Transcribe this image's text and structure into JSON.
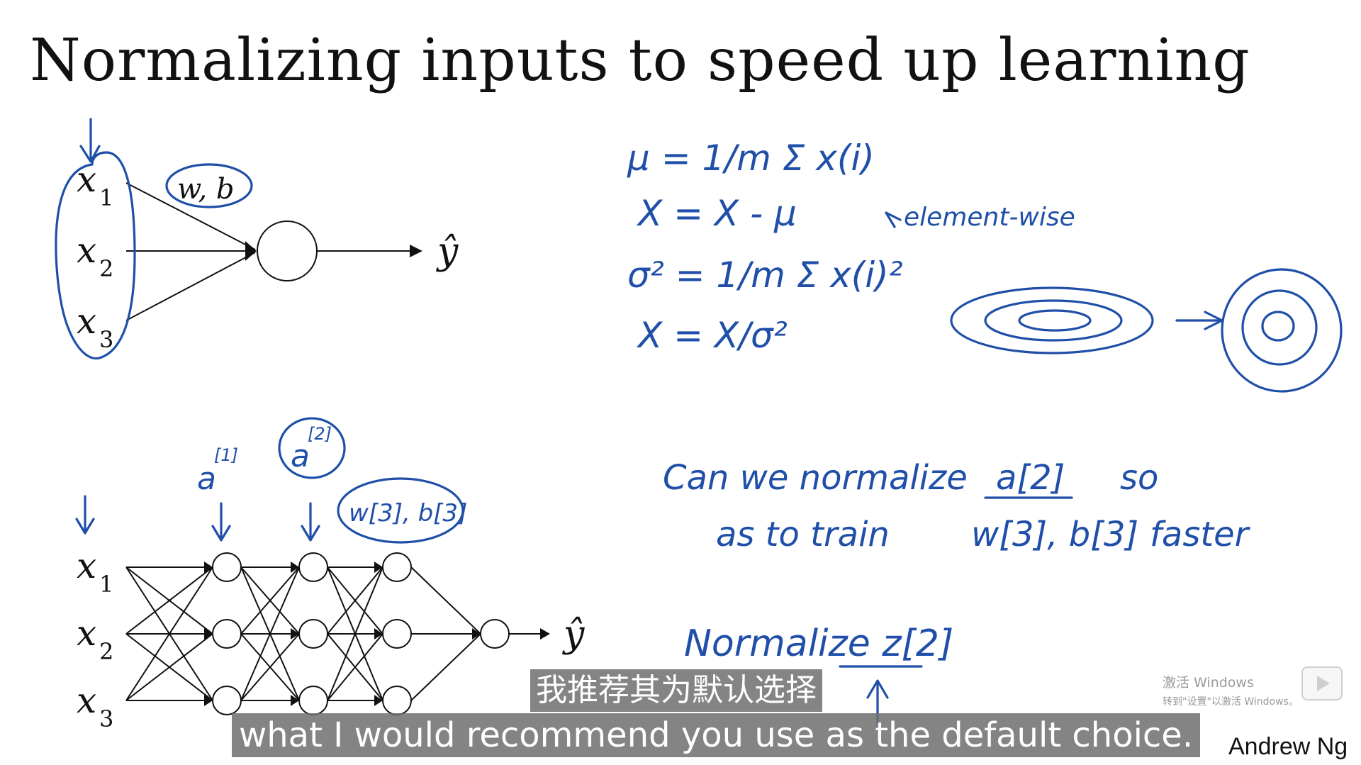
{
  "slide": {
    "title": "Normalizing inputs to speed up learning",
    "author": "Andrew Ng"
  },
  "network_small": {
    "inputs": [
      "x",
      "x",
      "x"
    ],
    "subscripts": [
      "1",
      "2",
      "3"
    ],
    "params_label": "w, b",
    "output": "ŷ"
  },
  "network_deep": {
    "inputs": [
      "x",
      "x",
      "x"
    ],
    "subscripts": [
      "1",
      "2",
      "3"
    ],
    "output": "ŷ",
    "activation_1": "a",
    "activation_1_sup": "[1]",
    "activation_2": "a",
    "activation_2_sup": "[2]",
    "params_label": "w[3], b[3]"
  },
  "handwriting": {
    "mu_eq": "μ = 1/m Σ x(i)",
    "sub_eq": "X = X - μ",
    "element_wise": "element-wise",
    "sigma_eq": "σ² = 1/m Σ x(i)²",
    "div_eq": "X = X/σ²",
    "question_line1": "Can we normalize",
    "question_a": "a[2]",
    "question_so": "so",
    "question_line2": "as to train",
    "question_wb": "w[3], b[3]",
    "question_faster": "faster",
    "normalize_z": "Normalize z[2]"
  },
  "subtitles": {
    "chinese": "我推荐其为默认选择",
    "english": "what I would recommend you use as the default choice."
  },
  "watermark": {
    "line1": "激活 Windows",
    "line2": "转到\"设置\"以激活 Windows。"
  }
}
